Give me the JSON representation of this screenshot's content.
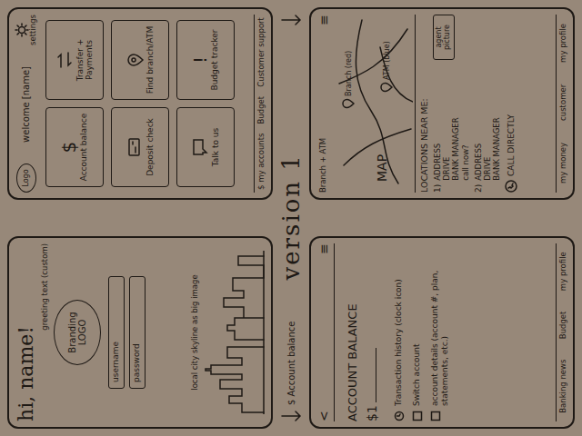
{
  "title": "version 1",
  "flow_label": "$ Account balance",
  "login": {
    "greeting": "hi, name!",
    "greeting_note": "greeting text (custom)",
    "logo": "Branding LOGO",
    "fields": [
      "username",
      "password"
    ],
    "image_note": "local city skyline as big image"
  },
  "home": {
    "logo": "Logo",
    "welcome": "welcome [name]",
    "settings": "settings",
    "tiles": [
      {
        "kind": "dollar",
        "glyph": "$",
        "label": "Account balance"
      },
      {
        "kind": "arrows",
        "glyph": "",
        "label": "Transfer + Payments"
      },
      {
        "kind": "check",
        "glyph": "",
        "label": "Deposit check"
      },
      {
        "kind": "pin",
        "glyph": "",
        "label": "Find branch/ATM"
      },
      {
        "kind": "chat",
        "glyph": "",
        "label": "Talk to us"
      },
      {
        "kind": "alert",
        "glyph": "!",
        "label": "Budget tracker"
      }
    ],
    "nav": [
      "$ my accounts",
      "Budget",
      "Customer support"
    ]
  },
  "account": {
    "back": "<",
    "menu": "≡",
    "title": "ACCOUNT BALANCE",
    "amount": "$1",
    "items": [
      {
        "kind": "clock",
        "label": "Transaction history (clock icon)"
      },
      {
        "kind": "box",
        "label": "Switch account"
      },
      {
        "kind": "box",
        "label": "account details (account #, plan, statements, etc.)"
      }
    ],
    "nav": [
      "Banking news",
      "Budget",
      "my profile"
    ]
  },
  "map": {
    "menu": "≡",
    "note": "Branch + ATM",
    "label": "MAP",
    "pins": [
      "Branch (red)",
      "ATM (blue)"
    ],
    "heading": "LOCATIONS NEAR ME:",
    "locations": [
      {
        "number": "1)",
        "lines": [
          "ADDRESS",
          "DRIVE",
          "BANK MANAGER",
          "call now?"
        ],
        "agent": "agent picture"
      },
      {
        "number": "2)",
        "lines": [
          "ADDRESS",
          "DRIVE",
          "BANK MANAGER"
        ],
        "agent": ""
      }
    ],
    "call": "CALL DIRECTLY",
    "nav": [
      "my money",
      "customer",
      "my profile"
    ]
  }
}
